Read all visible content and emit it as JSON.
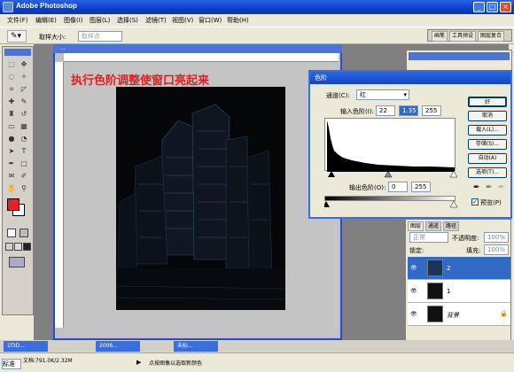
{
  "title": "Adobe Photoshop",
  "menus": [
    "文件(F)",
    "编辑(E)",
    "图像(I)",
    "图层(L)",
    "选择(S)",
    "滤镜(T)",
    "视图(V)",
    "窗口(W)",
    "帮助(H)"
  ],
  "options": {
    "sample_label": "取样大小:",
    "sample_value": "取样点"
  },
  "palette_well": [
    "画笔",
    "工具预设",
    "图层复合"
  ],
  "document": {
    "title": "...",
    "headline": "执行色阶调整使窗口亮起来"
  },
  "levels": {
    "title": "色阶",
    "channel_label": "通道(C):",
    "channel_value": "红",
    "input_label": "输入色阶(I):",
    "input_values": [
      "22",
      "1.35",
      "255"
    ],
    "output_label": "输出色阶(O):",
    "output_values": [
      "0",
      "255"
    ],
    "buttons": [
      "好",
      "取消",
      "载入(L)...",
      "存储(S)...",
      "自动(A)",
      "选项(T)..."
    ],
    "preview_label": "预览(P)",
    "preview_checked": true
  },
  "layers": {
    "tabs": [
      "图层",
      "通道",
      "路径"
    ],
    "blend_mode": "正常",
    "opacity_label": "不透明度:",
    "opacity": "100%",
    "lock_label": "锁定:",
    "fill_label": "填充:",
    "fill": "100%",
    "rows": [
      {
        "name": "2",
        "selected": true
      },
      {
        "name": "1",
        "selected": false
      },
      {
        "name": "背景",
        "selected": false
      }
    ]
  },
  "tasks": [
    "1f3D...",
    "2006...",
    "未标..."
  ],
  "status": {
    "zoom": "标准",
    "doc_size": "文档:791.0K/2.32M",
    "hint": "点按图像以选取新颜色"
  },
  "colors": {
    "foreground": "#e8202a",
    "background": "#ffffff",
    "accent": "#3a6ee0"
  }
}
